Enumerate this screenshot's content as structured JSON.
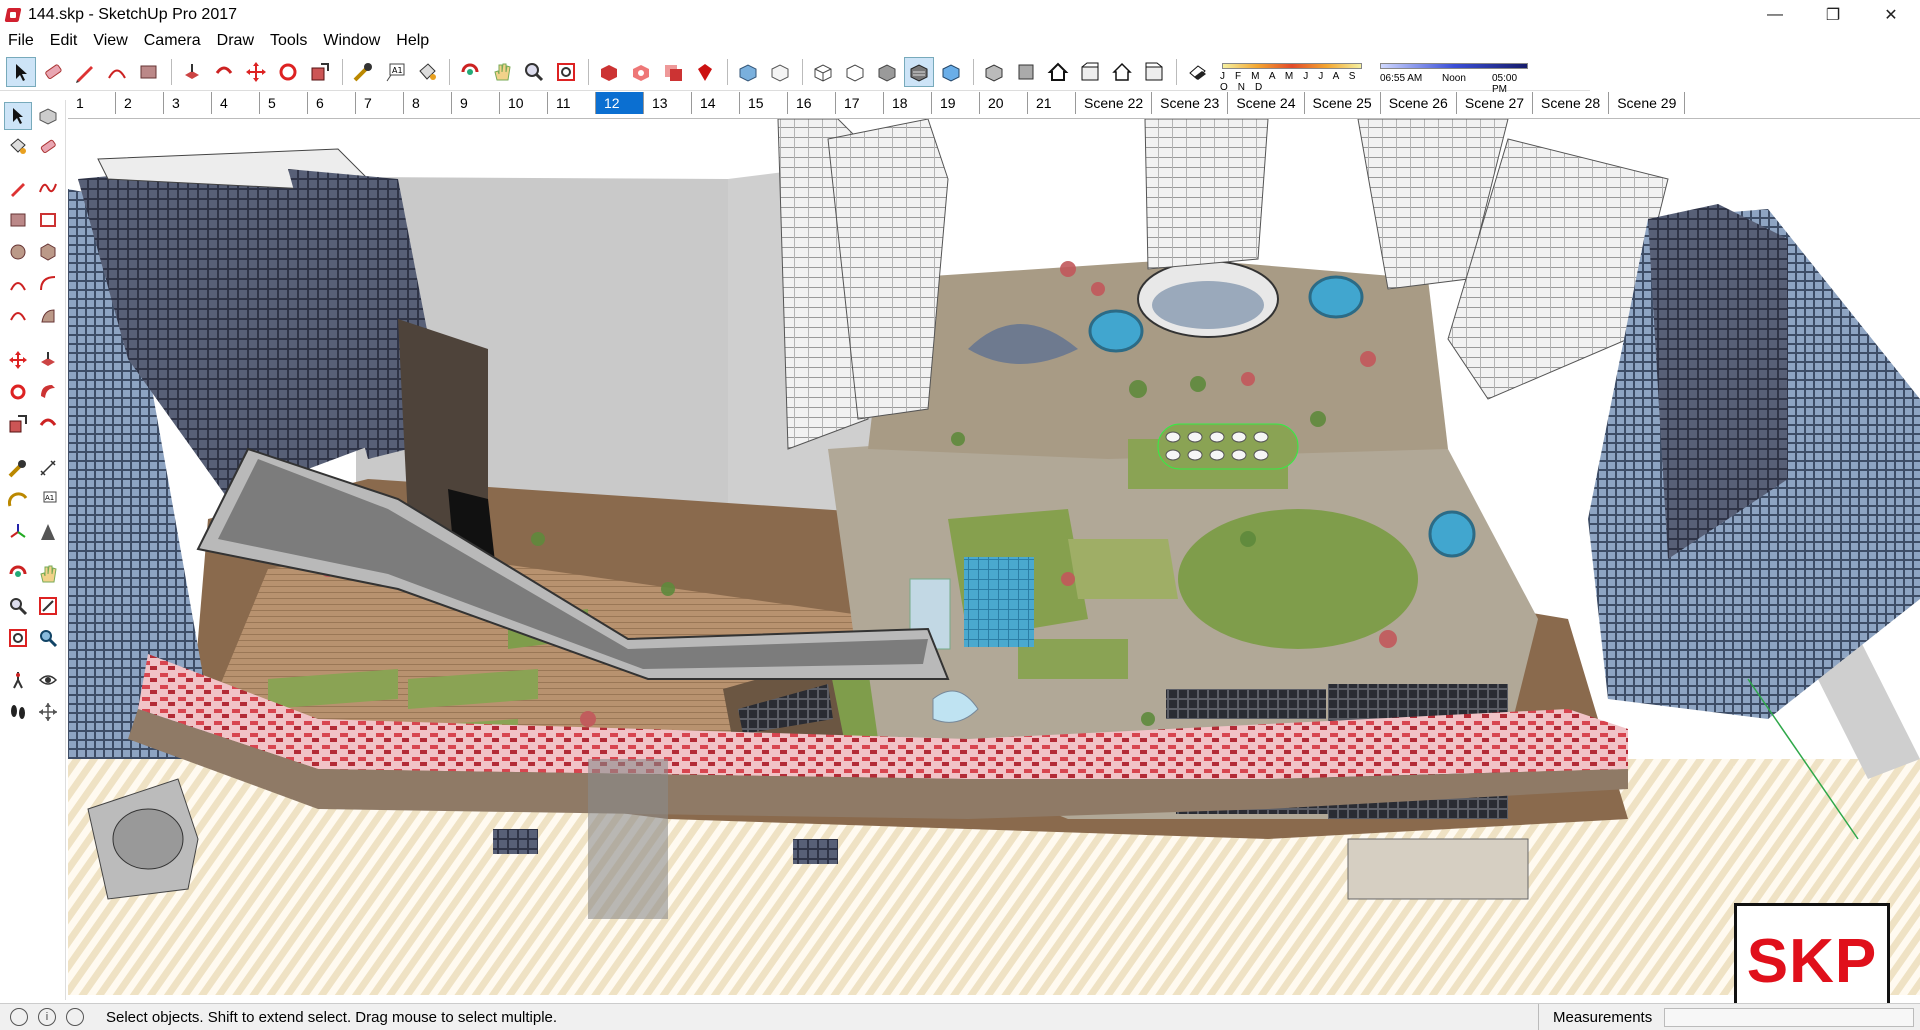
{
  "window": {
    "title": "144.skp - SketchUp Pro 2017",
    "minimize": "—",
    "maximize": "❐",
    "close": "✕"
  },
  "menu": [
    "File",
    "Edit",
    "View",
    "Camera",
    "Draw",
    "Tools",
    "Window",
    "Help"
  ],
  "shadows": {
    "months": "J F M A M J J A S O N D",
    "time_start": "06:55 AM",
    "time_mid": "Noon",
    "time_end": "05:00 PM"
  },
  "scenes": {
    "numbered": [
      "1",
      "2",
      "3",
      "4",
      "5",
      "6",
      "7",
      "8",
      "9",
      "10",
      "11",
      "12",
      "13",
      "14",
      "15",
      "16",
      "17",
      "18",
      "19",
      "20",
      "21"
    ],
    "named": [
      "Scene 22",
      "Scene 23",
      "Scene 24",
      "Scene 25",
      "Scene 26",
      "Scene 27",
      "Scene 28",
      "Scene 29"
    ],
    "active": "12"
  },
  "logo": {
    "text": "SKP",
    "color": "#e0101b"
  },
  "status": {
    "message": "Select objects. Shift to extend select. Drag mouse to select multiple.",
    "measurements_label": "Measurements",
    "measurements_value": ""
  },
  "colors": {
    "accent": "#0b6fd1",
    "brand": "#d1202f"
  }
}
